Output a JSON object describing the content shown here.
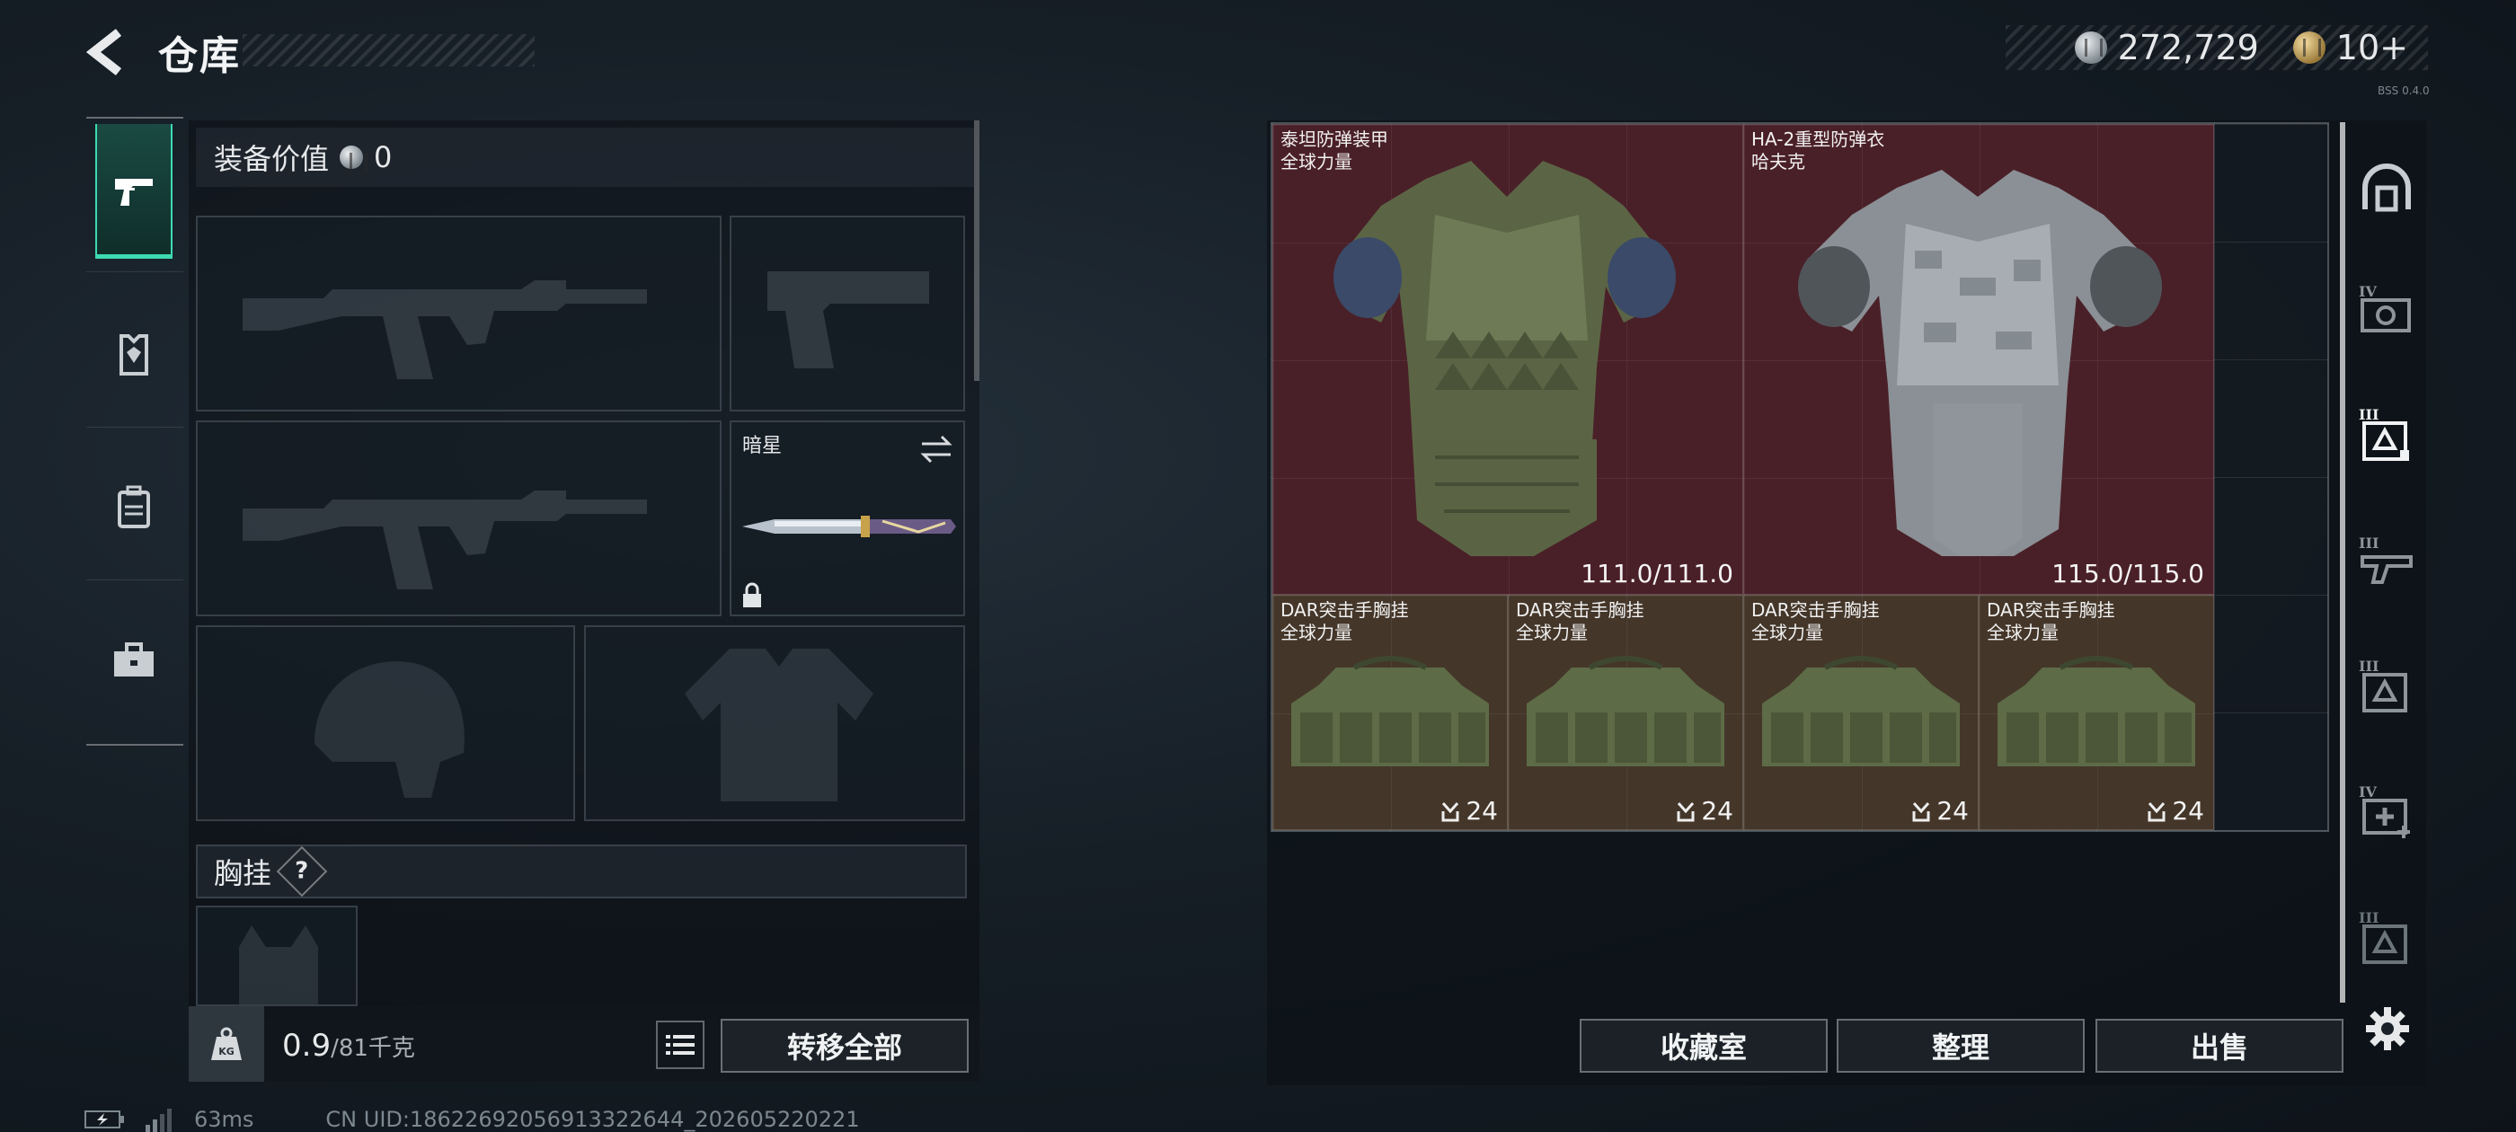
{
  "header": {
    "title": "仓库",
    "currency_main": "272,729",
    "currency_secondary": "10+",
    "version": "BSS 0.4.0"
  },
  "left_rail": {
    "tabs": [
      {
        "name": "weapons",
        "icon": "pistol-icon",
        "active": true
      },
      {
        "name": "armor",
        "icon": "armor-plate-icon",
        "active": false
      },
      {
        "name": "backpack",
        "icon": "backpack-icon",
        "active": false
      },
      {
        "name": "toolkit",
        "icon": "toolbox-icon",
        "active": false
      }
    ]
  },
  "loadout": {
    "equip_value_label": "装备价值",
    "equip_value": "0",
    "melee_slot_label": "暗星",
    "chest_rig_label": "胸挂",
    "help": "?",
    "weight_current": "0.9",
    "weight_max": "/81千克",
    "transfer_all_label": "转移全部"
  },
  "storage": {
    "items": [
      {
        "name": "泰坦防弹装甲",
        "sub": "全球力量",
        "durability": "111.0/111.0",
        "bg": "red"
      },
      {
        "name": "HA-2重型防弹衣",
        "sub": "哈夫克",
        "durability": "115.0/115.0",
        "bg": "red"
      },
      {
        "name": "DAR突击手胸挂",
        "sub": "全球力量",
        "capacity": "24",
        "bg": "brown"
      },
      {
        "name": "DAR突击手胸挂",
        "sub": "全球力量",
        "capacity": "24",
        "bg": "brown"
      },
      {
        "name": "DAR突击手胸挂",
        "sub": "全球力量",
        "capacity": "24",
        "bg": "brown"
      },
      {
        "name": "DAR突击手胸挂",
        "sub": "全球力量",
        "capacity": "24",
        "bg": "brown"
      }
    ],
    "buttons": {
      "collection": "收藏室",
      "organize": "整理",
      "sell": "出售"
    }
  },
  "side_filters": [
    {
      "icon": "helmet-filter-icon",
      "tier": ""
    },
    {
      "icon": "tier4-camera-icon",
      "tier": "IV"
    },
    {
      "icon": "tier3-armor-icon",
      "tier": "III"
    },
    {
      "icon": "tier3-weapon-icon",
      "tier": "III"
    },
    {
      "icon": "tier3-armor-icon-2",
      "tier": "III"
    },
    {
      "icon": "tier4-medkit-icon",
      "tier": "IV"
    },
    {
      "icon": "tier3-misc-icon",
      "tier": "III"
    }
  ],
  "status": {
    "ping": "63ms",
    "uid": "CN UID:18622692056913322644_202605220221"
  },
  "colors": {
    "accent": "#3dd9b3",
    "armor_bg": "#4a2028",
    "rig_bg": "#443629"
  }
}
